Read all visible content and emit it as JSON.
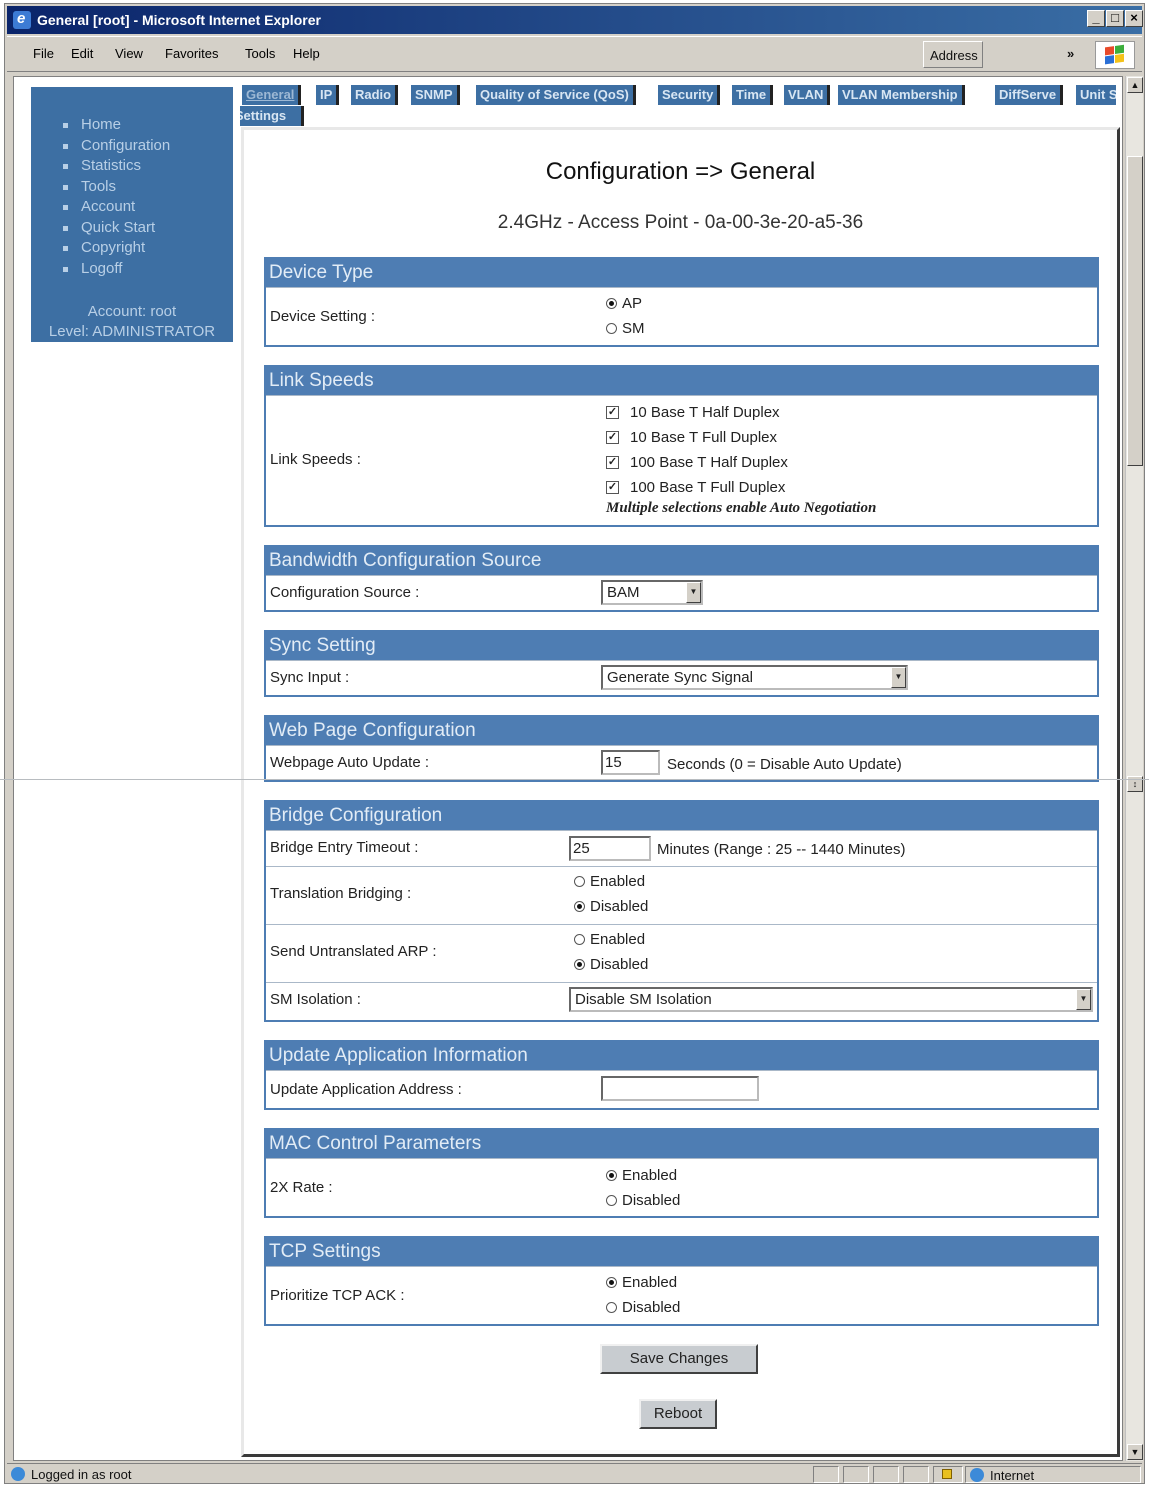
{
  "window": {
    "title": "General [root] - Microsoft Internet Explorer",
    "controls": [
      "_",
      "□",
      "×"
    ]
  },
  "menubar": {
    "items": [
      "File",
      "Edit",
      "View",
      "Favorites",
      "Tools",
      "Help"
    ],
    "address_label": "Address",
    "chevron": "»"
  },
  "sidebar": {
    "items": [
      "Home",
      "Configuration",
      "Statistics",
      "Tools",
      "Account",
      "Quick Start",
      "Copyright",
      "Logoff"
    ],
    "account": "Account: root",
    "level": "Level: ADMINISTRATOR"
  },
  "tabs": [
    "General",
    "IP",
    "Radio",
    "SNMP",
    "Quality of Service (QoS)",
    "Security",
    "Time",
    "VLAN",
    "VLAN Membership",
    "DiffServe",
    "Unit Settings"
  ],
  "page": {
    "title": "Configuration => General",
    "subtitle": "2.4GHz - Access Point - 0a-00-3e-20-a5-36"
  },
  "device_type": {
    "header": "Device Type",
    "label": "Device Setting :",
    "options": [
      "AP",
      "SM"
    ],
    "selected": "AP"
  },
  "link_speeds": {
    "header": "Link Speeds",
    "label": "Link Speeds :",
    "options": [
      "10 Base T Half Duplex",
      "10 Base T Full Duplex",
      "100 Base T Half Duplex",
      "100 Base T Full Duplex"
    ],
    "checked": [
      true,
      true,
      true,
      true
    ],
    "note": "Multiple selections enable Auto Negotiation"
  },
  "bandwidth": {
    "header": "Bandwidth Configuration Source",
    "label": "Configuration Source :",
    "value": "BAM"
  },
  "sync": {
    "header": "Sync Setting",
    "label": "Sync Input :",
    "value": "Generate Sync Signal"
  },
  "webpage": {
    "header": "Web Page Configuration",
    "label": "Webpage Auto Update :",
    "value": "15",
    "unit": "Seconds (0 = Disable Auto Update)"
  },
  "bridge": {
    "header": "Bridge Configuration",
    "timeout_label": "Bridge Entry Timeout :",
    "timeout_value": "25",
    "timeout_unit": "Minutes (Range : 25 -- 1440 Minutes)",
    "translation_label": "Translation Bridging :",
    "translation_options": [
      "Enabled",
      "Disabled"
    ],
    "translation_selected": "Disabled",
    "arp_label": "Send Untranslated ARP :",
    "arp_options": [
      "Enabled",
      "Disabled"
    ],
    "arp_selected": "Disabled",
    "isolation_label": "SM Isolation :",
    "isolation_value": "Disable SM Isolation"
  },
  "update_app": {
    "header": "Update Application Information",
    "label": "Update Application Address :",
    "value": ""
  },
  "mac": {
    "header": "MAC Control Parameters",
    "label": "2X Rate :",
    "options": [
      "Enabled",
      "Disabled"
    ],
    "selected": "Enabled"
  },
  "tcp": {
    "header": "TCP Settings",
    "label": "Prioritize TCP ACK :",
    "options": [
      "Enabled",
      "Disabled"
    ],
    "selected": "Enabled"
  },
  "buttons": {
    "save": "Save Changes",
    "reboot": "Reboot"
  },
  "statusbar": {
    "text": "Logged in as root",
    "zone": "Internet"
  }
}
